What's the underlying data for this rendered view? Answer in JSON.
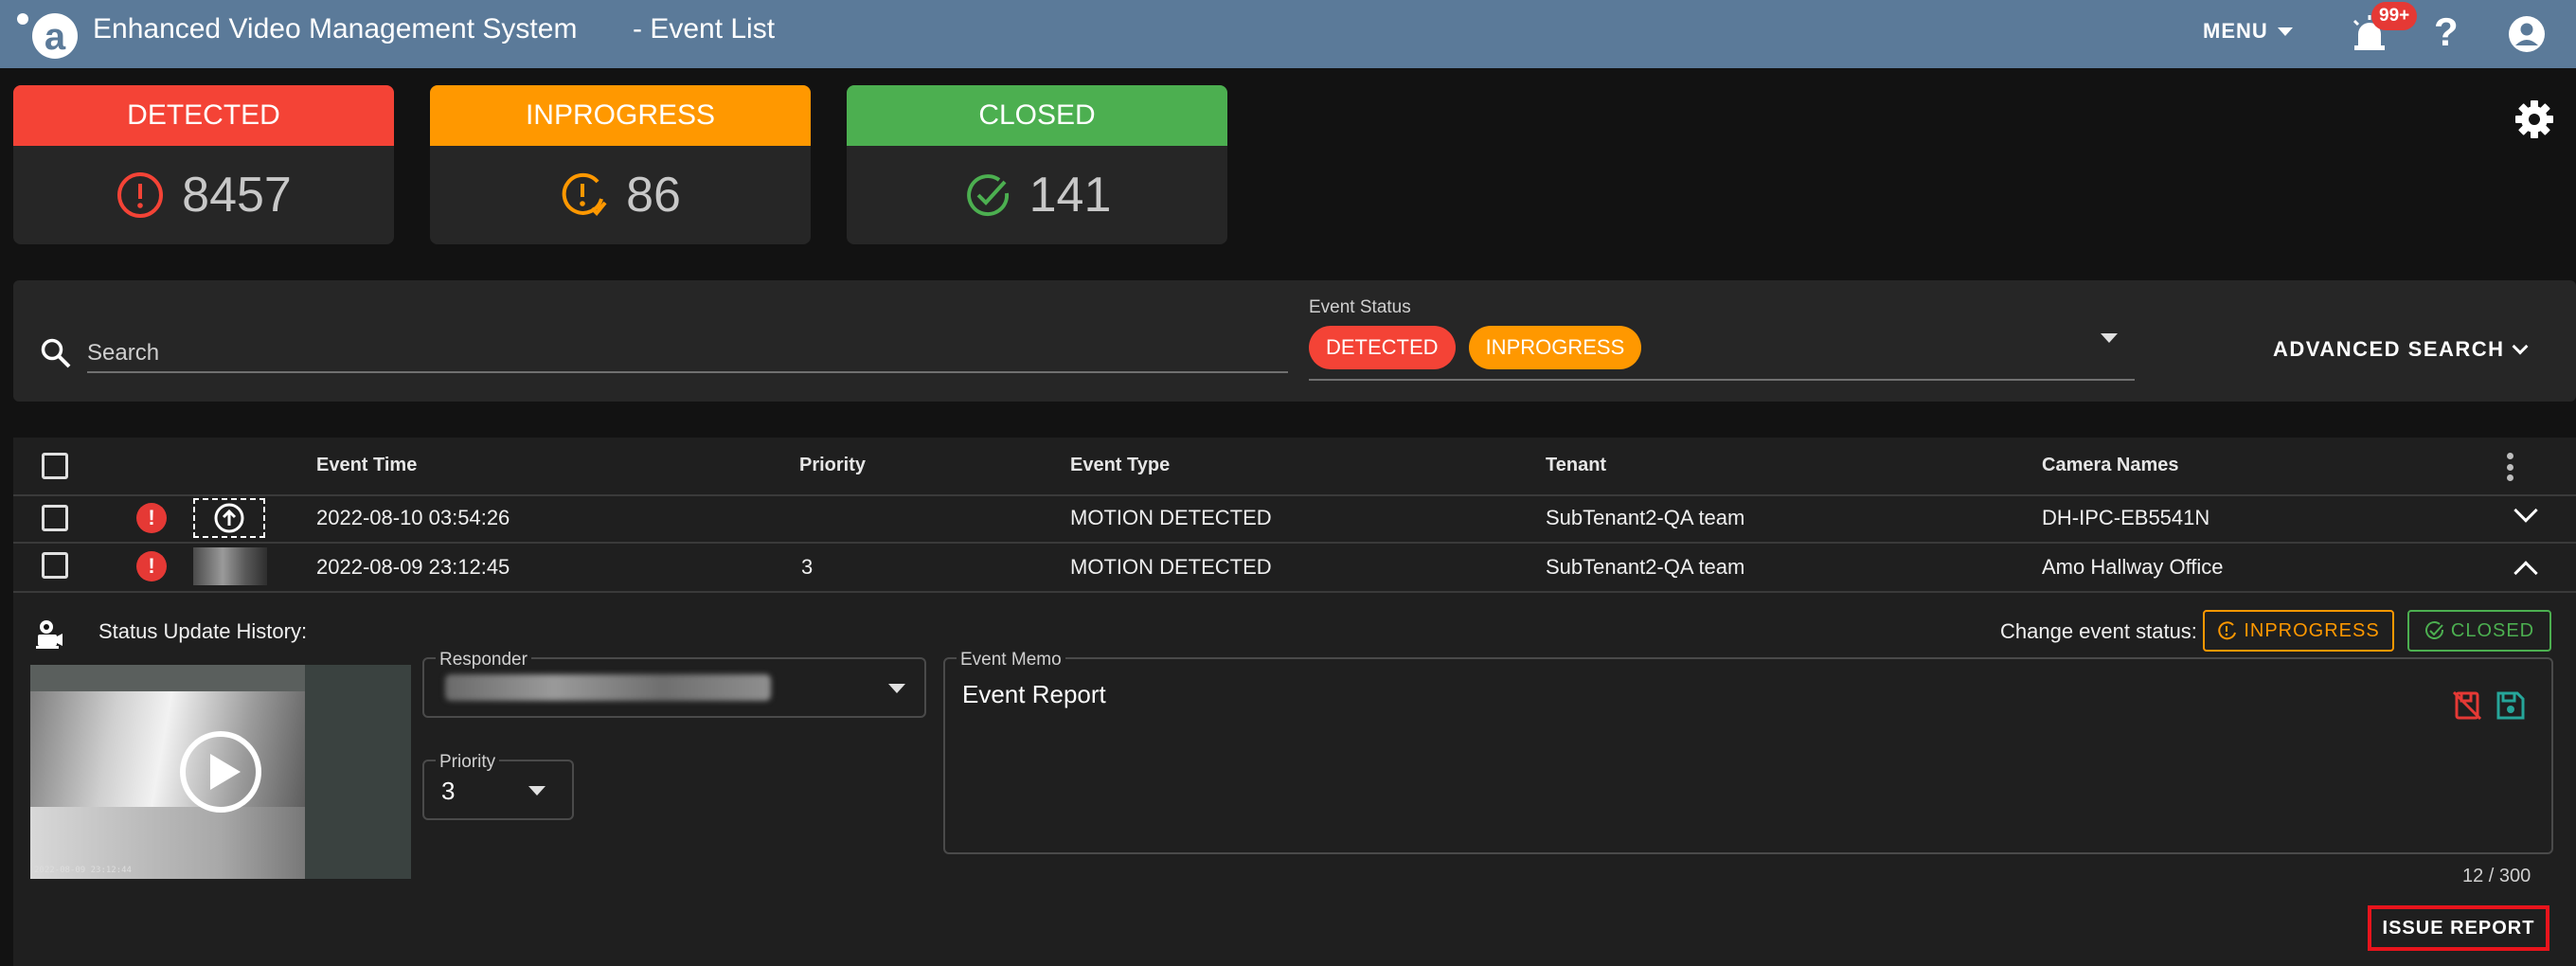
{
  "header": {
    "app_title": "Enhanced Video Management System",
    "page_title": "- Event List",
    "menu_label": "MENU",
    "notification_badge": "99+",
    "help_symbol": "?",
    "color": "#5b7a99"
  },
  "status_cards": [
    {
      "label": "DETECTED",
      "count": "8457",
      "color": "#f44336",
      "icon": "alert-circle-icon"
    },
    {
      "label": "INPROGRESS",
      "count": "86",
      "color": "#ff9800",
      "icon": "clock-alert-icon"
    },
    {
      "label": "CLOSED",
      "count": "141",
      "color": "#4caf50",
      "icon": "check-circle-icon"
    }
  ],
  "search": {
    "placeholder": "Search",
    "event_status_label": "Event Status",
    "chips": [
      {
        "label": "DETECTED",
        "color": "#f44336"
      },
      {
        "label": "INPROGRESS",
        "color": "#ff9800"
      }
    ],
    "advanced_search_label": "ADVANCED SEARCH"
  },
  "table": {
    "columns": [
      "Event Time",
      "Priority",
      "Event Type",
      "Tenant",
      "Camera Names"
    ],
    "rows": [
      {
        "event_time": "2022-08-10 03:54:26",
        "priority": "",
        "event_type": "MOTION DETECTED",
        "tenant": "SubTenant2-QA team",
        "camera": "DH-IPC-EB5541N",
        "expanded": false
      },
      {
        "event_time": "2022-08-09 23:12:45",
        "priority": "3",
        "event_type": "MOTION DETECTED",
        "tenant": "SubTenant2-QA team",
        "camera": "Amo Hallway Office",
        "expanded": true
      }
    ]
  },
  "detail": {
    "history_label": "Status Update History:",
    "change_status_label": "Change event status:",
    "btn_inprogress": "INPROGRESS",
    "btn_closed": "CLOSED",
    "responder_label": "Responder",
    "priority_label": "Priority",
    "priority_value": "3",
    "memo_label": "Event Memo",
    "memo_text": "Event Report",
    "char_counter": "12 / 300",
    "issue_report_label": "ISSUE REPORT",
    "video_timestamp": "2022-08-09 23:12:44"
  }
}
